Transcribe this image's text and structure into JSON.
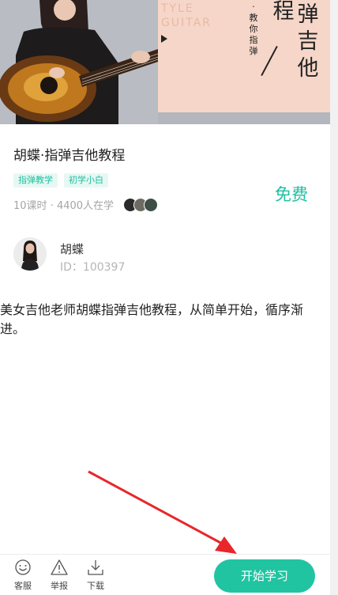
{
  "banner": {
    "english_text_line1": "TYLE",
    "english_text_line2": "GUITAR",
    "slogan_vertical": "·教你指弹",
    "big_col1": "程",
    "big_col2": "弹吉他"
  },
  "course": {
    "title": "胡蝶·指弹吉他教程",
    "tags": [
      "指弹教学",
      "初学小白"
    ],
    "meta": "10课时 · 4400人在学",
    "price": "免费"
  },
  "teacher": {
    "name": "胡蝶",
    "id_text": "ID：100397"
  },
  "description": "美女吉他老师胡蝶指弹吉他教程，从简单开始，循序渐进。",
  "bottom_bar": {
    "service_label": "客服",
    "report_label": "举报",
    "download_label": "下载",
    "start_button": "开始学习"
  },
  "colors": {
    "accent": "#21c4a0",
    "annotation_arrow": "#e8262b"
  }
}
